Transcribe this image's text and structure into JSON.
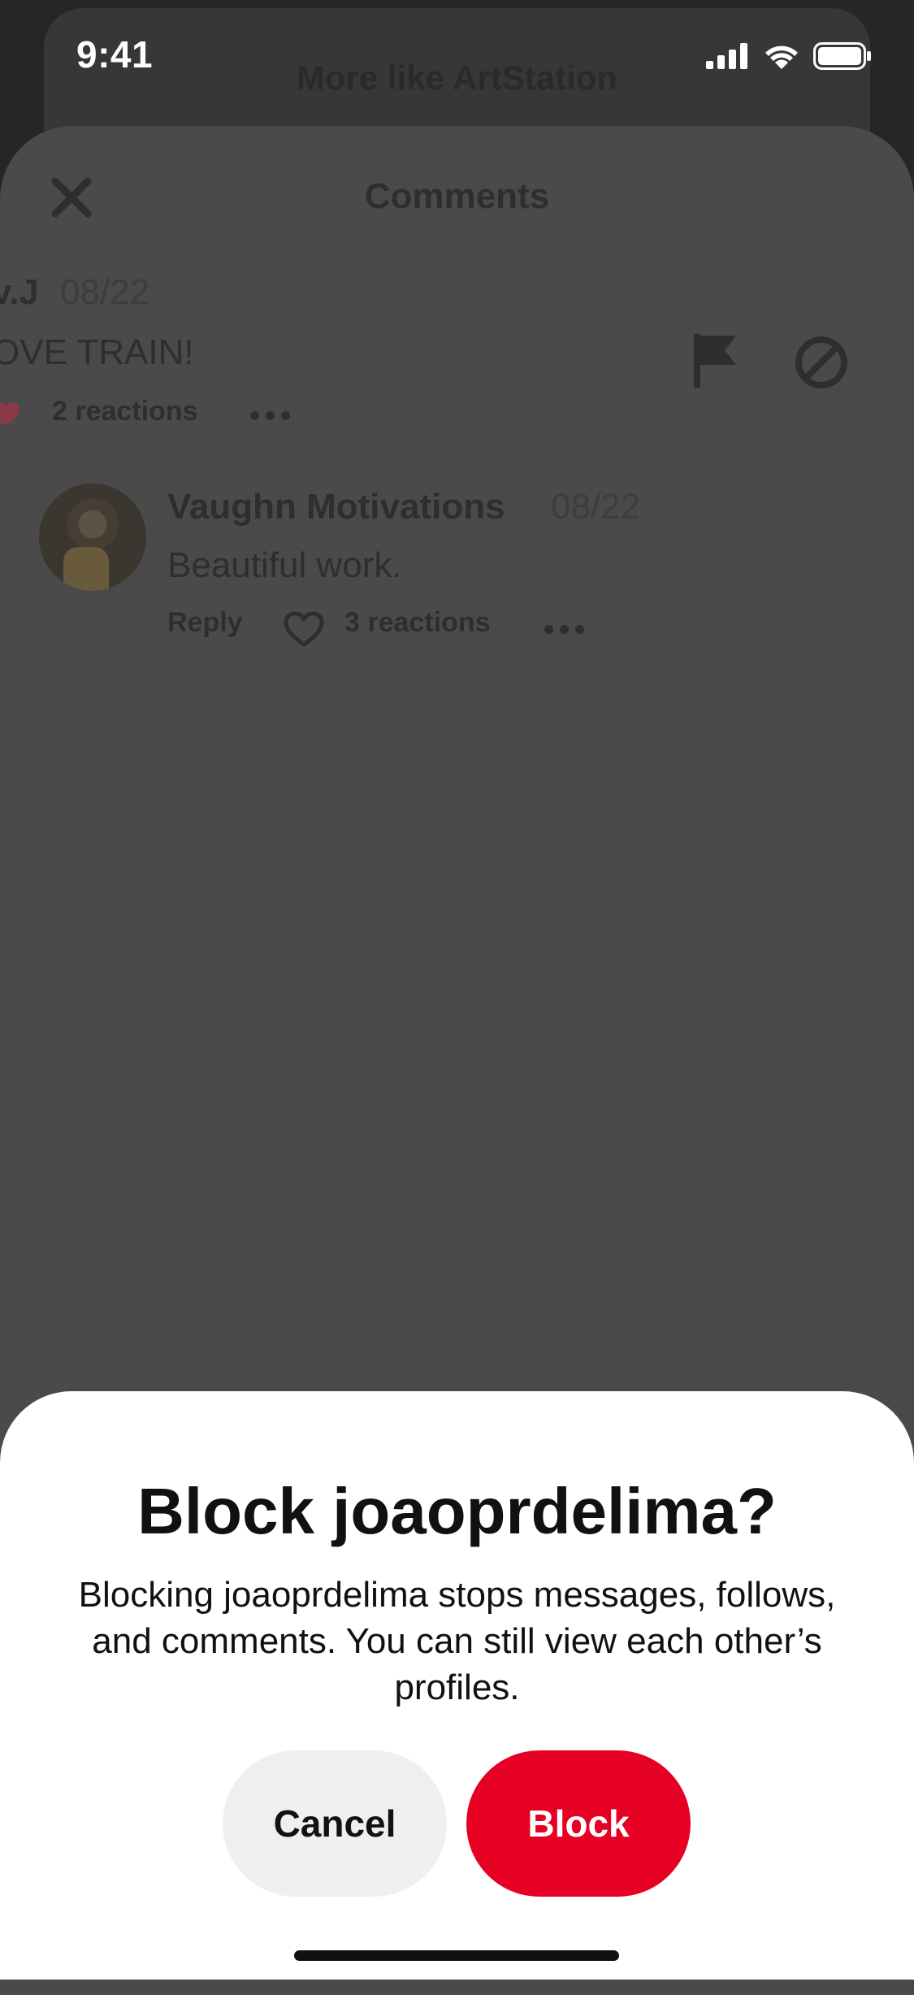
{
  "status_bar": {
    "time": "9:41"
  },
  "background_card": {
    "title": "More like ArtStation"
  },
  "comments_sheet": {
    "title": "Comments",
    "comments": [
      {
        "author": "v.J",
        "date": "08/22",
        "text": "OVE TRAIN!",
        "reactions": "2 reactions"
      },
      {
        "author": "Vaughn Motivations",
        "date": "08/22",
        "text": "Beautiful work.",
        "reply_label": "Reply",
        "reactions": "3 reactions"
      }
    ]
  },
  "block_dialog": {
    "title": "Block joaoprdelima?",
    "body": "Blocking joaoprdelima stops messages, follows, and comments. You can still view each other’s profiles.",
    "cancel_label": "Cancel",
    "block_label": "Block"
  },
  "colors": {
    "accent": "#e60023",
    "overlay": "#4a4a4a",
    "cancel_bg": "#efefef"
  },
  "icons": [
    "close-icon",
    "flag-icon",
    "block-icon",
    "heart-icon",
    "more-icon",
    "signal-icon",
    "wifi-icon",
    "battery-icon"
  ]
}
